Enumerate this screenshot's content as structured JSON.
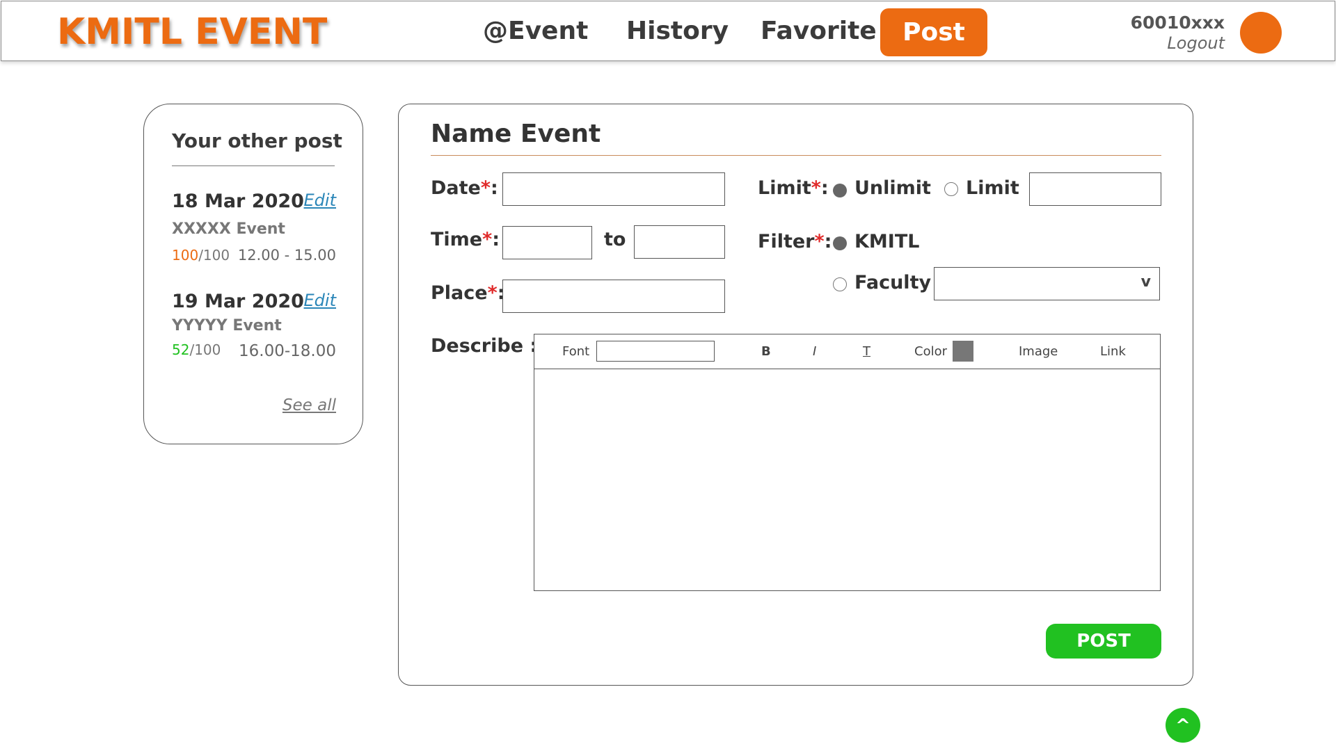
{
  "header": {
    "logo": "KMITL EVENT",
    "nav": [
      {
        "label": "@Event"
      },
      {
        "label": "History"
      },
      {
        "label": "Favorite"
      },
      {
        "label": "Post"
      }
    ],
    "user_id": "60010xxx",
    "logout_label": "Logout",
    "accent_color": "#ec6b12"
  },
  "sidebar": {
    "title": "Your other post",
    "posts": [
      {
        "date": "18 Mar 2020",
        "edit_label": "Edit",
        "name": "XXXXX Event",
        "count": "100",
        "count_total": "/100",
        "count_color": "#ec6b12",
        "time": "12.00 - 15.00"
      },
      {
        "date": "19 Mar 2020",
        "edit_label": "Edit",
        "name": "YYYYY Event",
        "count": "52",
        "count_total": "/100",
        "count_color": "#21c121",
        "time": "16.00-18.00"
      }
    ],
    "see_all_label": "See all"
  },
  "form": {
    "title": "Name Event",
    "date_label": "Date",
    "time_label": "Time",
    "to_label": "to",
    "place_label": "Place",
    "limit_label": "Limit",
    "limit_options": [
      "Unlimit",
      "Limit"
    ],
    "limit_selected": "Unlimit",
    "filter_label": "Filter",
    "filter_options": [
      "KMITL",
      "Faculty"
    ],
    "filter_selected": "KMITL",
    "faculty_caret": "v",
    "required_mark": "*",
    "colon": ":",
    "describe_label": "Describe :",
    "toolbar": {
      "font": "Font",
      "bold": "B",
      "italic": "I",
      "underline": "T",
      "color": "Color",
      "image": "Image",
      "link": "Link"
    },
    "post_button": "POST"
  },
  "scroll_top_label": "^"
}
